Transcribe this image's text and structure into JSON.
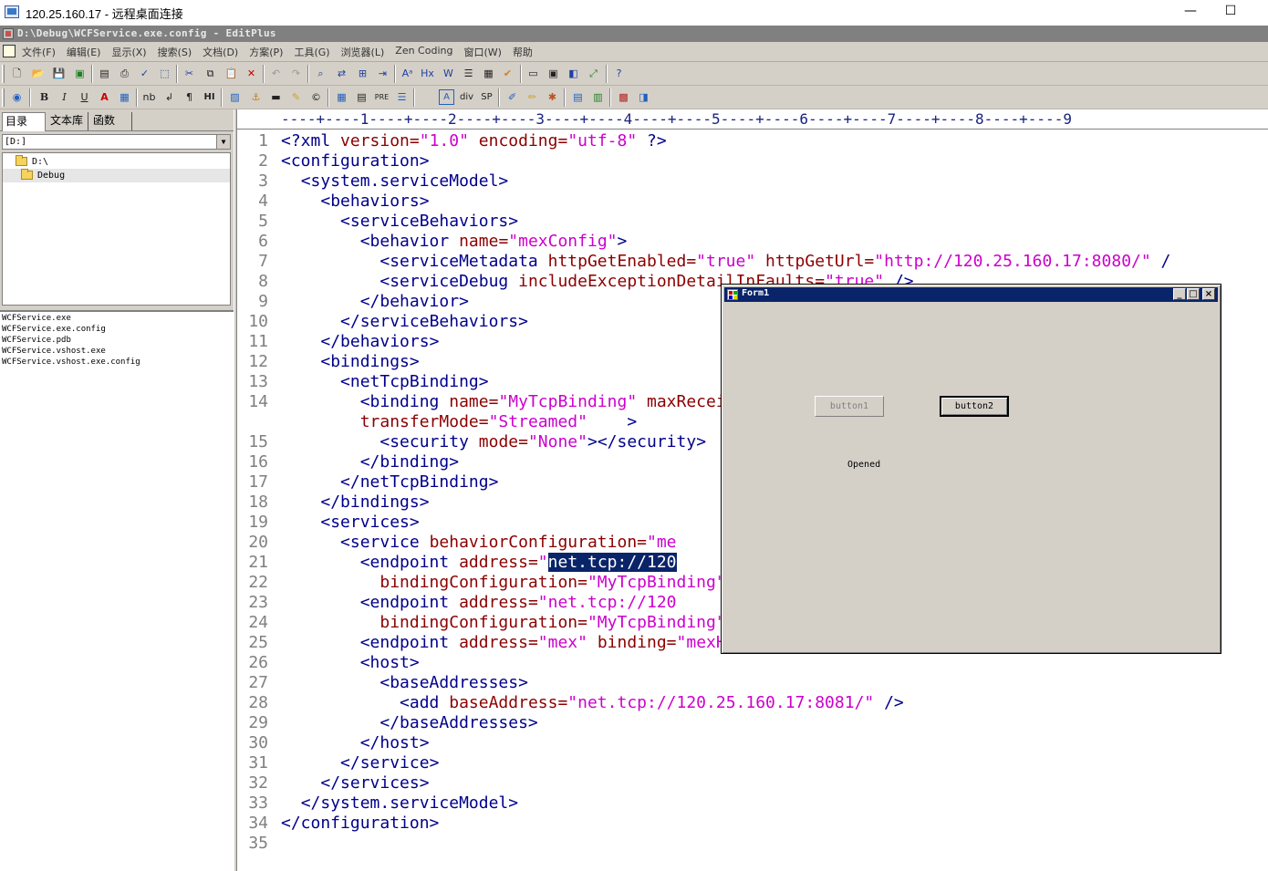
{
  "rdp": {
    "title": "120.25.160.17 - 远程桌面连接",
    "minimize": "—",
    "maximize": "☐"
  },
  "editplus": {
    "title": "D:\\Debug\\WCFService.exe.config - EditPlus"
  },
  "menu": [
    "文件(F)",
    "编辑(E)",
    "显示(X)",
    "搜索(S)",
    "文档(D)",
    "方案(P)",
    "工具(G)",
    "浏览器(L)",
    "Zen Coding",
    "窗口(W)",
    "帮助"
  ],
  "toolbar2_labels": {
    "bold": "B",
    "italic": "I",
    "underline": "U",
    "font_color": "A",
    "nb": "nb",
    "para": "¶",
    "hr": "HI",
    "pre": "PRE",
    "div": "div",
    "sp": "SP",
    "hx": "Hx"
  },
  "left_panel": {
    "tabs": [
      "目录",
      "文本库",
      "函数"
    ],
    "drive": "[D:]",
    "tree": [
      "D:\\",
      "Debug"
    ],
    "files": [
      "WCFService.exe",
      "WCFService.exe.config",
      "WCFService.pdb",
      "WCFService.vshost.exe",
      "WCFService.vshost.exe.config"
    ]
  },
  "ruler": "----+----1----+----2----+----3----+----4----+----5----+----6----+----7----+----8----+----9",
  "editor": {
    "line_numbers": [
      "1",
      "2",
      "3",
      "4",
      "5",
      "6",
      "7",
      "8",
      "9",
      "10",
      "11",
      "12",
      "13",
      "14",
      "",
      "15",
      "16",
      "17",
      "18",
      "19",
      "20",
      "21",
      "22",
      "23",
      "24",
      "25",
      "26",
      "27",
      "28",
      "29",
      "30",
      "31",
      "32",
      "33",
      "34",
      "35"
    ]
  },
  "form1": {
    "title": "Form1",
    "button1": "button1",
    "button2": "button2",
    "status": "Opened",
    "min": "_",
    "max": "□",
    "close": "×"
  },
  "colors": {
    "tag": "#00008b",
    "attr": "#8b0000",
    "value": "#cc00cc",
    "selection": "#0a246a"
  }
}
